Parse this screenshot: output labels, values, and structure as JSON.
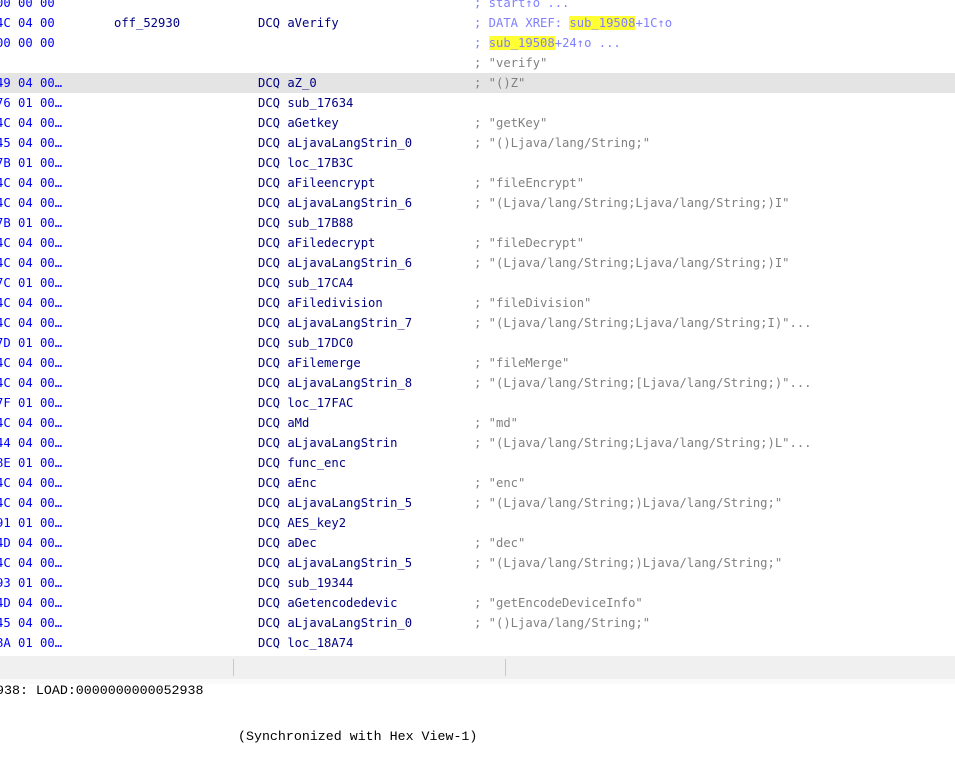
{
  "rows": [
    {
      "bytes": "00 00 00",
      "label": "",
      "instr": "",
      "comment": [
        {
          "t": "; start↑o ..."
        }
      ],
      "xref": true
    },
    {
      "bytes": "4C 04 00",
      "label": "off_52930",
      "instr": "DCQ aVerify",
      "comment": [
        {
          "t": "; DATA XREF: "
        },
        {
          "t": "sub_19508",
          "hl": true
        },
        {
          "t": "+1C↑o"
        }
      ],
      "xref": true
    },
    {
      "bytes": "00 00 00",
      "label": "",
      "instr": "",
      "comment": [
        {
          "t": "; "
        },
        {
          "t": "sub_19508",
          "hl": true
        },
        {
          "t": "+24↑o ..."
        }
      ],
      "xref": true
    },
    {
      "bytes": "",
      "label": "",
      "instr": "",
      "comment": [
        {
          "t": "; \"verify\""
        }
      ]
    },
    {
      "bytes": "49 04 00…",
      "label": "",
      "instr": "DCQ aZ_0",
      "comment": [
        {
          "t": "; \"()Z\""
        }
      ],
      "selected": true
    },
    {
      "bytes": "76 01 00…",
      "label": "",
      "instr": "DCQ sub_17634",
      "comment": []
    },
    {
      "bytes": "4C 04 00…",
      "label": "",
      "instr": "DCQ aGetkey",
      "comment": [
        {
          "t": "; \"getKey\""
        }
      ]
    },
    {
      "bytes": "45 04 00…",
      "label": "",
      "instr": "DCQ aLjavaLangStrin_0",
      "comment": [
        {
          "t": "; \"()Ljava/lang/String;\""
        }
      ]
    },
    {
      "bytes": "7B 01 00…",
      "label": "",
      "instr": "DCQ loc_17B3C",
      "comment": []
    },
    {
      "bytes": "4C 04 00…",
      "label": "",
      "instr": "DCQ aFileencrypt",
      "comment": [
        {
          "t": "; \"fileEncrypt\""
        }
      ]
    },
    {
      "bytes": "4C 04 00…",
      "label": "",
      "instr": "DCQ aLjavaLangStrin_6",
      "comment": [
        {
          "t": "; \"(Ljava/lang/String;Ljava/lang/String;)I\""
        }
      ]
    },
    {
      "bytes": "7B 01 00…",
      "label": "",
      "instr": "DCQ sub_17B88",
      "comment": []
    },
    {
      "bytes": "4C 04 00…",
      "label": "",
      "instr": "DCQ aFiledecrypt",
      "comment": [
        {
          "t": "; \"fileDecrypt\""
        }
      ]
    },
    {
      "bytes": "4C 04 00…",
      "label": "",
      "instr": "DCQ aLjavaLangStrin_6",
      "comment": [
        {
          "t": "; \"(Ljava/lang/String;Ljava/lang/String;)I\""
        }
      ]
    },
    {
      "bytes": "7C 01 00…",
      "label": "",
      "instr": "DCQ sub_17CA4",
      "comment": []
    },
    {
      "bytes": "4C 04 00…",
      "label": "",
      "instr": "DCQ aFiledivision",
      "comment": [
        {
          "t": "; \"fileDivision\""
        }
      ]
    },
    {
      "bytes": "4C 04 00…",
      "label": "",
      "instr": "DCQ aLjavaLangStrin_7",
      "comment": [
        {
          "t": "; \"(Ljava/lang/String;Ljava/lang/String;I)\"..."
        }
      ]
    },
    {
      "bytes": "7D 01 00…",
      "label": "",
      "instr": "DCQ sub_17DC0",
      "comment": []
    },
    {
      "bytes": "4C 04 00…",
      "label": "",
      "instr": "DCQ aFilemerge",
      "comment": [
        {
          "t": "; \"fileMerge\""
        }
      ]
    },
    {
      "bytes": "4C 04 00…",
      "label": "",
      "instr": "DCQ aLjavaLangStrin_8",
      "comment": [
        {
          "t": "; \"(Ljava/lang/String;[Ljava/lang/String;)\"..."
        }
      ]
    },
    {
      "bytes": "7F 01 00…",
      "label": "",
      "instr": "DCQ loc_17FAC",
      "comment": []
    },
    {
      "bytes": "4C 04 00…",
      "label": "",
      "instr": "DCQ aMd",
      "comment": [
        {
          "t": "; \"md\""
        }
      ]
    },
    {
      "bytes": "44 04 00…",
      "label": "",
      "instr": "DCQ aLjavaLangStrin",
      "comment": [
        {
          "t": "; \"(Ljava/lang/String;Ljava/lang/String;)L\"..."
        }
      ]
    },
    {
      "bytes": "8E 01 00…",
      "label": "",
      "instr": "DCQ func_enc",
      "comment": []
    },
    {
      "bytes": "4C 04 00…",
      "label": "",
      "instr": "DCQ aEnc",
      "comment": [
        {
          "t": "; \"enc\""
        }
      ]
    },
    {
      "bytes": "4C 04 00…",
      "label": "",
      "instr": "DCQ aLjavaLangStrin_5",
      "comment": [
        {
          "t": "; \"(Ljava/lang/String;)Ljava/lang/String;\""
        }
      ]
    },
    {
      "bytes": "91 01 00…",
      "label": "",
      "instr": "DCQ AES_key2",
      "comment": []
    },
    {
      "bytes": "4D 04 00…",
      "label": "",
      "instr": "DCQ aDec",
      "comment": [
        {
          "t": "; \"dec\""
        }
      ]
    },
    {
      "bytes": "4C 04 00…",
      "label": "",
      "instr": "DCQ aLjavaLangStrin_5",
      "comment": [
        {
          "t": "; \"(Ljava/lang/String;)Ljava/lang/String;\""
        }
      ]
    },
    {
      "bytes": "93 01 00…",
      "label": "",
      "instr": "DCQ sub_19344",
      "comment": []
    },
    {
      "bytes": "4D 04 00…",
      "label": "",
      "instr": "DCQ aGetencodedevic",
      "comment": [
        {
          "t": "; \"getEncodeDeviceInfo\""
        }
      ]
    },
    {
      "bytes": "45 04 00…",
      "label": "",
      "instr": "DCQ aLjavaLangStrin_0",
      "comment": [
        {
          "t": "; \"()Ljava/lang/String;\""
        }
      ]
    },
    {
      "bytes": "8A 01 00…",
      "label": "",
      "instr": "DCQ loc_18A74",
      "comment": []
    }
  ],
  "status": {
    "address": "938: LOAD:0000000000052938",
    "sync": "(Synchronized with Hex View-1)"
  },
  "colors": {
    "bytes": "#0000ff",
    "code": "#000080",
    "comment": "#808080",
    "xref": "#8080ff",
    "highlight": "#ffff33",
    "selected_row": "#e4e4e4"
  }
}
